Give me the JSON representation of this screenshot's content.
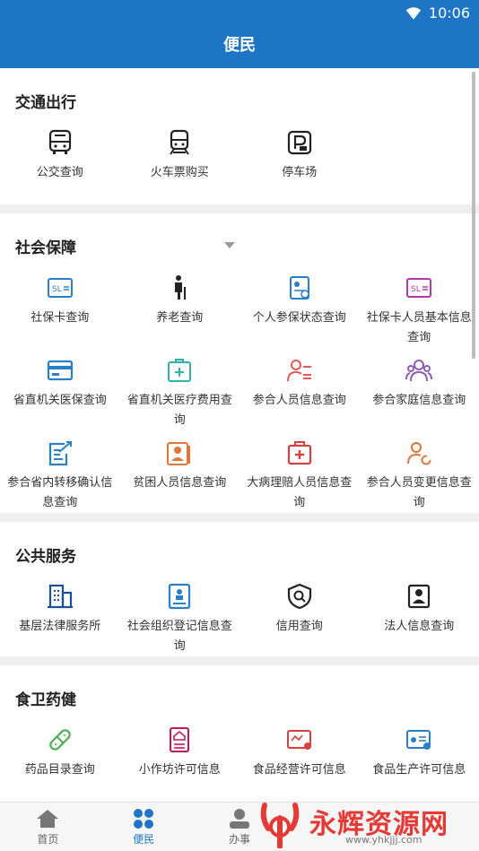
{
  "status": {
    "time": "10:06"
  },
  "title": "便民",
  "sections": [
    {
      "title": "交通出行",
      "items": [
        {
          "label": "公交查询",
          "icon": "bus-icon"
        },
        {
          "label": "火车票购买",
          "icon": "train-icon"
        },
        {
          "label": "停车场",
          "icon": "parking-icon"
        }
      ]
    },
    {
      "title": "社会保障",
      "items": [
        {
          "label": "社保卡查询",
          "icon": "sl-card-icon"
        },
        {
          "label": "养老查询",
          "icon": "elderly-icon"
        },
        {
          "label": "个人参保状态查询",
          "icon": "id-card-icon"
        },
        {
          "label": "社保卡人员基本信息查询",
          "icon": "sl-card-icon"
        },
        {
          "label": "省直机关医保查询",
          "icon": "bank-card-icon"
        },
        {
          "label": "省直机关医疗费用查询",
          "icon": "medical-case-icon"
        },
        {
          "label": "参合人员信息查询",
          "icon": "person-list-icon"
        },
        {
          "label": "参合家庭信息查询",
          "icon": "family-icon"
        },
        {
          "label": "参合省内转移确认信息查询",
          "icon": "transfer-doc-icon"
        },
        {
          "label": "贫困人员信息查询",
          "icon": "profile-card-icon"
        },
        {
          "label": "大病理赔人员信息查询",
          "icon": "first-aid-icon"
        },
        {
          "label": "参合人员变更信息查询",
          "icon": "person-refresh-icon"
        }
      ]
    },
    {
      "title": "公共服务",
      "items": [
        {
          "label": "基层法律服务所",
          "icon": "building-icon"
        },
        {
          "label": "社会组织登记信息查询",
          "icon": "org-doc-icon"
        },
        {
          "label": "信用查询",
          "icon": "credit-shield-icon"
        },
        {
          "label": "法人信息查询",
          "icon": "legal-person-icon"
        }
      ]
    },
    {
      "title": "食卫药健",
      "items": [
        {
          "label": "药品目录查询",
          "icon": "pill-icon"
        },
        {
          "label": "小作坊许可信息",
          "icon": "workshop-doc-icon"
        },
        {
          "label": "食品经营许可信息",
          "icon": "food-license-icon"
        },
        {
          "label": "食品生产许可信息",
          "icon": "production-license-icon"
        }
      ]
    }
  ],
  "tabs": [
    {
      "label": "首页",
      "icon": "home-icon"
    },
    {
      "label": "便民",
      "icon": "grid-icon",
      "active": true
    },
    {
      "label": "办事",
      "icon": "user-icon"
    },
    {
      "label": "",
      "icon": ""
    },
    {
      "label": "",
      "icon": ""
    }
  ],
  "watermark": {
    "text": "永辉资源网",
    "url": "www.yhkjjj.com"
  },
  "colors": {
    "primary": "#1e75c6",
    "social_blue": "#2a7fc9",
    "social_pink": "#d24a7a",
    "social_red": "#e55a5a",
    "social_purple": "#8b5cb8",
    "social_orange": "#e0763a",
    "social_teal": "#2fb5a8"
  }
}
